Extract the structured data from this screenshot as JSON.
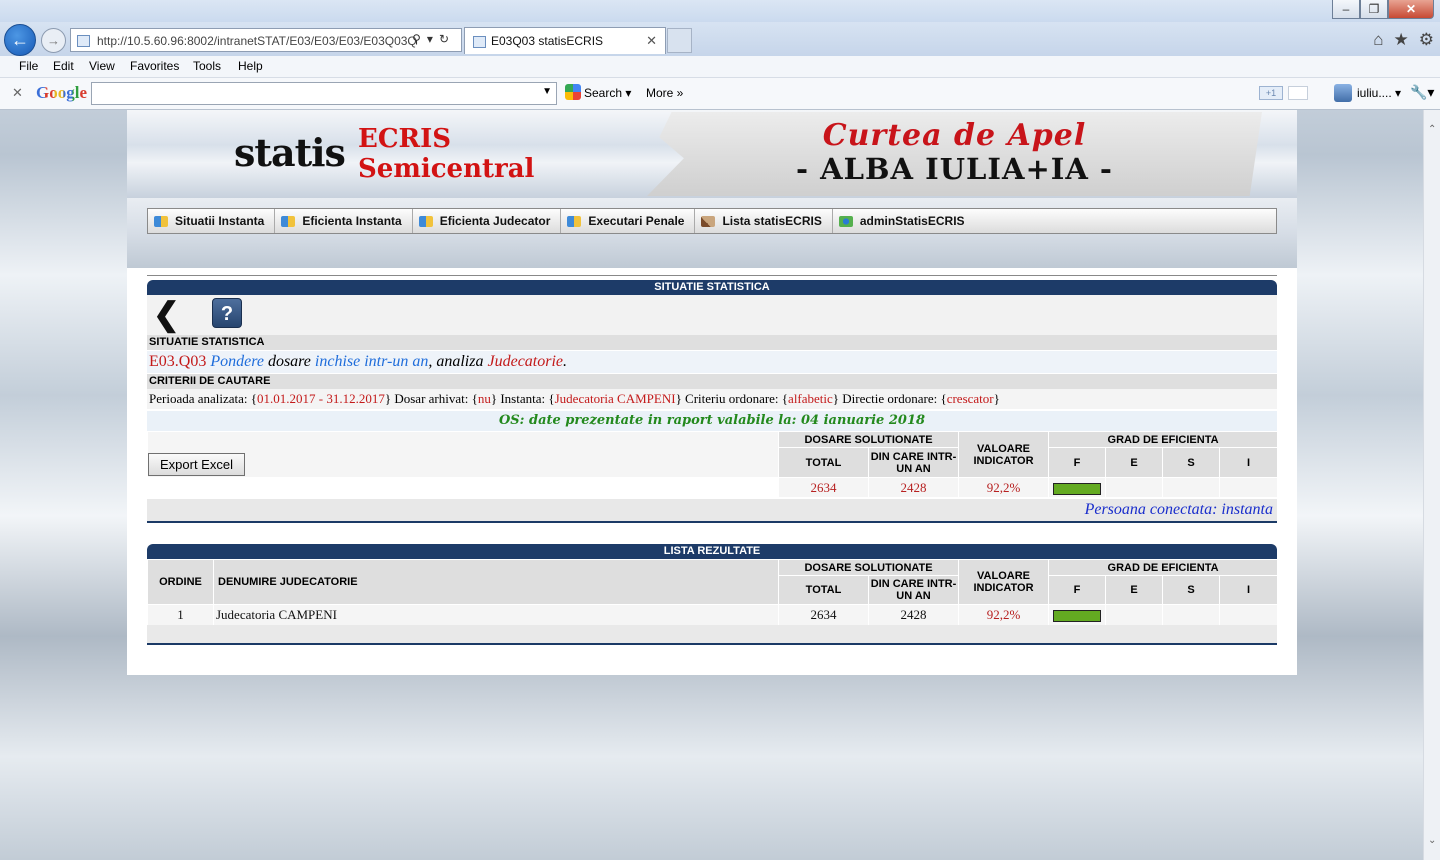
{
  "browser": {
    "address": "http://10.5.60.96:8002/intranetSTAT/E03/E03/E03/E03Q03Q",
    "tab_title": "E03Q03 statisECRIS",
    "menu": [
      "File",
      "Edit",
      "View",
      "Favorites",
      "Tools",
      "Help"
    ],
    "google_logo": "Google",
    "search_label": "Search",
    "more_label": "More",
    "plus_label": "+1",
    "user_label": "iuliu...."
  },
  "header": {
    "logo_statis": "statis",
    "logo_ecris": "ECRIS",
    "logo_semicentral": "Semicentral",
    "court_line1": "Curtea de Apel",
    "court_line2": "- ALBA IULIA+IA -"
  },
  "nav": [
    {
      "label": "Situatii Instanta",
      "icon": "database-icon"
    },
    {
      "label": "Eficienta Instanta",
      "icon": "database-icon"
    },
    {
      "label": "Eficienta Judecator",
      "icon": "database-icon"
    },
    {
      "label": "Executari Penale",
      "icon": "database-icon"
    },
    {
      "label": "Lista statisECRIS",
      "icon": "gavel-icon"
    },
    {
      "label": "adminStatisECRIS",
      "icon": "network-icon"
    }
  ],
  "summary": {
    "section_title": "SITUATIE STATISTICA",
    "subhead": "SITUATIE STATISTICA",
    "code": "E03.Q03",
    "desc_1": "Pondere",
    "desc_2": "dosare",
    "desc_3": "inchise intr-un an",
    "desc_4": ", analiza",
    "desc_5": "Judecatorie",
    "desc_6": ".",
    "criteria_title": "CRITERII DE CAUTARE",
    "crit_p_label": "Perioada analizata: {",
    "crit_p_val": "01.01.2017 - 31.12.2017",
    "crit_a_label": "} Dosar arhivat: {",
    "crit_a_val": "nu",
    "crit_i_label": "} Instanta: {",
    "crit_i_val": "Judecatoria CAMPENI",
    "crit_c_label": "} Criteriu ordonare: {",
    "crit_c_val": "alfabetic",
    "crit_d_label": "} Directie ordonare: {",
    "crit_d_val": "crescator",
    "crit_end": "}",
    "os_note": "OS: date prezentate in raport valabile la: 04 ianuarie 2018",
    "export_label": "Export Excel",
    "col_dosare": "DOSARE SOLUTIONATE",
    "col_total": "TOTAL",
    "col_din_care": "DIN CARE INTR-UN AN",
    "col_valoare": "VALOARE INDICATOR",
    "col_grad": "GRAD DE EFICIENTA",
    "grad_f": "F",
    "grad_e": "E",
    "grad_s": "S",
    "grad_i": "I",
    "total": "2634",
    "din_care": "2428",
    "valoare": "92,2%",
    "grad_level": "F",
    "grad_color": "#63aa21",
    "persoana": "Persoana conectata: instanta"
  },
  "results": {
    "section_title": "LISTA REZULTATE",
    "col_ordine": "ORDINE",
    "col_denumire": "DENUMIRE JUDECATORIE",
    "col_dosare": "DOSARE SOLUTIONATE",
    "col_total": "TOTAL",
    "col_din_care": "DIN CARE INTR-UN AN",
    "col_valoare": "VALOARE INDICATOR",
    "col_grad": "GRAD DE EFICIENTA",
    "grad_f": "F",
    "grad_e": "E",
    "grad_s": "S",
    "grad_i": "I",
    "rows": [
      {
        "ordine": "1",
        "denumire": "Judecatoria CAMPENI",
        "total": "2634",
        "din_care": "2428",
        "valoare": "92,2%",
        "grad_level": "F"
      }
    ]
  }
}
